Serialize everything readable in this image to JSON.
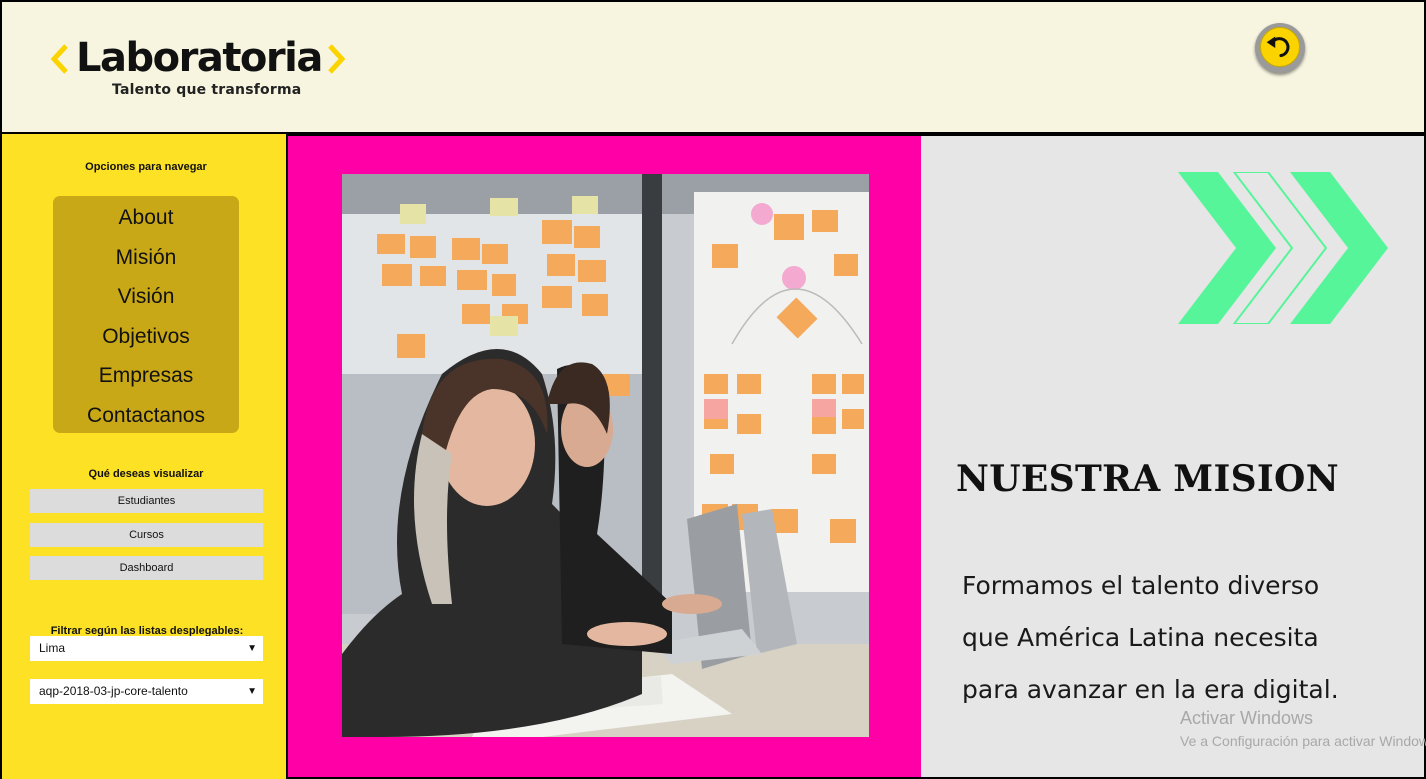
{
  "header": {
    "brand": "Laboratoria",
    "tagline": "Talento que transforma",
    "back_icon": "undo-arrow-icon"
  },
  "sidebar": {
    "nav_heading": "Opciones para navegar",
    "nav_items": [
      "About",
      "Misión",
      "Visión",
      "Objetivos",
      "Empresas",
      "Contactanos"
    ],
    "view_heading": "Qué deseas visualizar",
    "view_buttons": [
      "Estudiantes",
      "Cursos",
      "Dashboard"
    ],
    "filter_heading": "Filtrar según las listas desplegables:",
    "select_city": "Lima",
    "select_cohort": "aqp-2018-03-jp-core-talento"
  },
  "main": {
    "title": "NUESTRA MISION",
    "lines": [
      "Formamos el talento diverso",
      "que América Latina necesita",
      "para avanzar en la era digital."
    ],
    "watermark_line1": "Activar Windows",
    "watermark_line2": "Ve a Configuración para activar Windows."
  },
  "colors": {
    "header_bg": "#f7f5e0",
    "sidebar_bg": "#fde124",
    "nav_box": "#c9a817",
    "pink": "#ff00a6",
    "accent_green": "#56f59a",
    "brand_yellow": "#fbd400"
  }
}
